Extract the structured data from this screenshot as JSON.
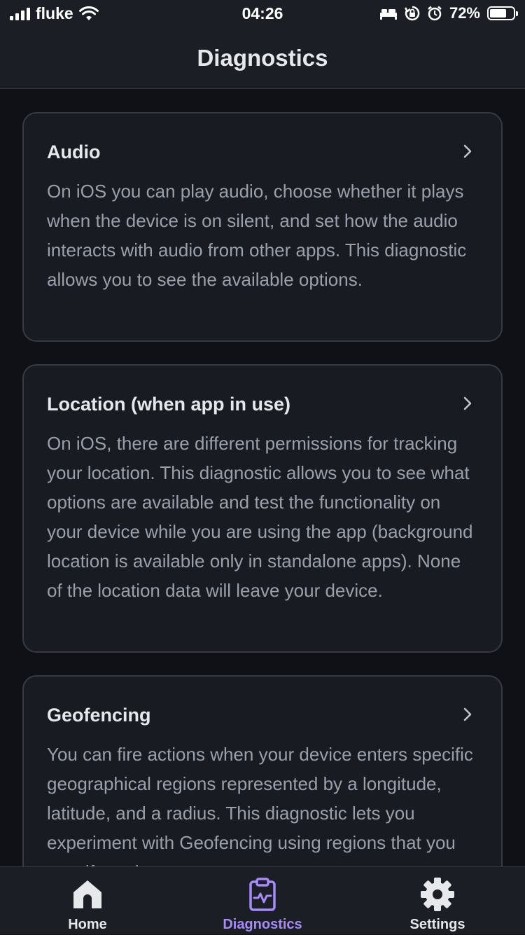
{
  "status_bar": {
    "carrier": "fluke",
    "time": "04:26",
    "battery_percent": "72%",
    "battery_level": 0.72,
    "icons": [
      "signal-icon",
      "wifi-icon",
      "bed-icon",
      "rotation-lock-icon",
      "alarm-icon",
      "battery-icon"
    ]
  },
  "header": {
    "title": "Diagnostics"
  },
  "cards": [
    {
      "title": "Audio",
      "description": "On iOS you can play audio, choose whether it plays when the device is on silent, and set how the audio interacts with audio from other apps. This diagnostic allows you to see the available options."
    },
    {
      "title": "Location (when app in use)",
      "description": "On iOS, there are different permissions for tracking your location. This diagnostic allows you to see what options are available and test the functionality on your device while you are using the app (background location is available only in standalone apps). None of the location data will leave your device."
    },
    {
      "title": "Geofencing",
      "description": "You can fire actions when your device enters specific geographical regions represented by a longitude, latitude, and a radius. This diagnostic lets you experiment with Geofencing using regions that you specify and"
    }
  ],
  "tabs": [
    {
      "label": "Home",
      "icon": "home-icon",
      "active": false
    },
    {
      "label": "Diagnostics",
      "icon": "clipboard-pulse-icon",
      "active": true
    },
    {
      "label": "Settings",
      "icon": "gear-icon",
      "active": false
    }
  ],
  "colors": {
    "accent": "#a78bfa",
    "tab_inactive": "#e6e8ec",
    "background": "#0f1117",
    "card_border": "#353a44",
    "description_text": "#9aa0ab"
  }
}
